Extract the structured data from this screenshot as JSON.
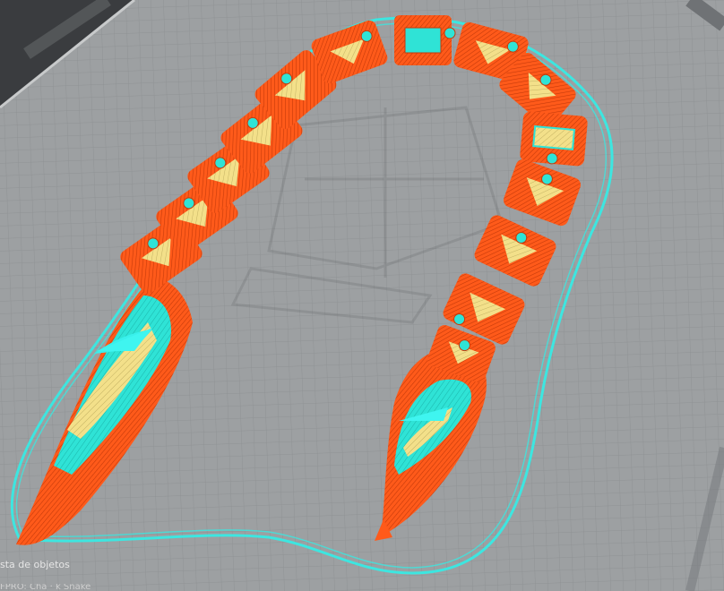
{
  "app": {
    "view": "layer-preview"
  },
  "colors": {
    "background": "#3a3c3f",
    "build_plate": "#9da0a2",
    "plate_grid": "#8e9193",
    "plate_edge": "#c8cacb",
    "wall_outer": "#ff5a1a",
    "wall_stripe": "#c43a0a",
    "skin": "#2fe3d6",
    "infill": "#f3e08a",
    "skirt": "#3de6e0"
  },
  "model": {
    "name": "",
    "type": "articulated-snake",
    "segment_count": 16
  },
  "object_list": {
    "label": "sta de objetos",
    "subtitle": "FPRO: Cha · k Snake"
  }
}
